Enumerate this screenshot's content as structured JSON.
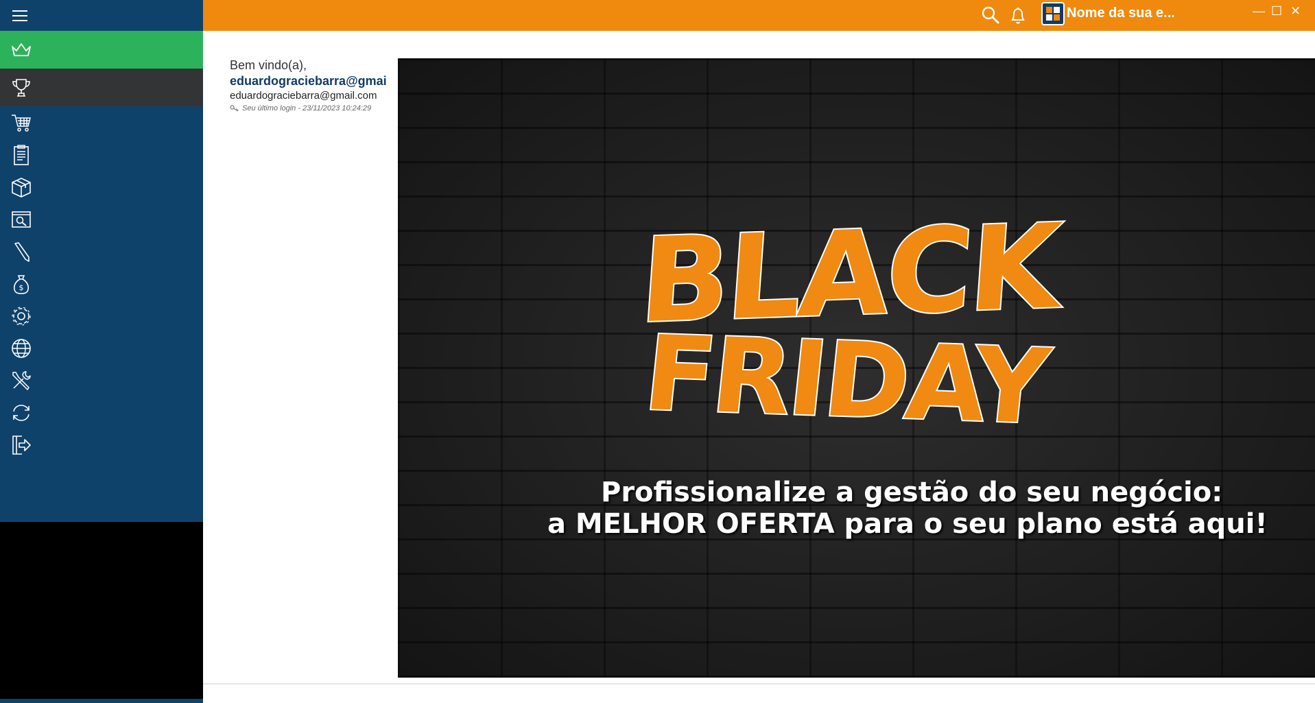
{
  "topbar": {
    "company_name": "Nome da sua e...",
    "search_icon": "search-icon",
    "bell_icon": "bell-icon",
    "minimize_glyph": "—",
    "maximize_glyph": "☐",
    "close_glyph": "✕"
  },
  "sidebar": {
    "items": [
      {
        "icon": "crown-icon"
      },
      {
        "icon": "trophy-icon"
      },
      {
        "icon": "cart-icon"
      },
      {
        "icon": "clipboard-icon"
      },
      {
        "icon": "box-icon"
      },
      {
        "icon": "search-window-icon"
      },
      {
        "icon": "pencil-icon"
      },
      {
        "icon": "money-bag-icon"
      },
      {
        "icon": "gear-icon"
      },
      {
        "icon": "globe-icon"
      },
      {
        "icon": "tools-icon"
      },
      {
        "icon": "sync-icon"
      },
      {
        "icon": "logout-icon"
      }
    ]
  },
  "welcome": {
    "greeting": "Bem vindo(a),",
    "username": "eduardogracіebarra@gmai",
    "email": "eduardogracіebarra@gmail.com",
    "last_login": "Seu último login - 23/11/2023 10:24:29"
  },
  "banner": {
    "title_line1": "BLACK",
    "title_line2": "FRIDAY",
    "promo_line1": "Profissionalize a gestão do seu negócio:",
    "promo_line2_prefix": "a ",
    "promo_line2_bold": "MELHOR OFERTA",
    "promo_line2_suffix": " para o seu plano está aqui!"
  },
  "colors": {
    "sidebar": "#0f426b",
    "topbar": "#ef8a0e",
    "active_green": "#2db25c",
    "active_dark": "#333436"
  }
}
